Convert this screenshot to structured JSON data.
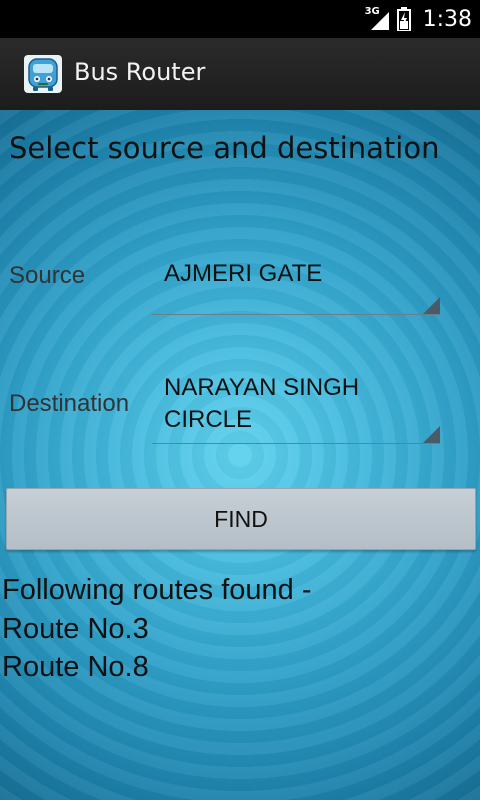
{
  "status_bar": {
    "network": "3G",
    "time": "1:38",
    "icons": [
      "signal-icon",
      "battery-icon"
    ]
  },
  "action_bar": {
    "title": "Bus Router",
    "icon": "bus-app-icon"
  },
  "form": {
    "heading": "Select source and destination",
    "source_label": "Source",
    "source_value": "AJMERI GATE",
    "destination_label": "Destination",
    "destination_value_line1": "NARAYAN SINGH",
    "destination_value_line2": "CIRCLE",
    "find_label": "FIND"
  },
  "results": {
    "header": "Following routes found -",
    "routes": [
      "Route No.3",
      "Route No.8"
    ]
  },
  "colors": {
    "background_center": "#5fd2ee",
    "background_edge": "#176f96",
    "action_bar": "#222222",
    "button": "#bcc6cd"
  }
}
